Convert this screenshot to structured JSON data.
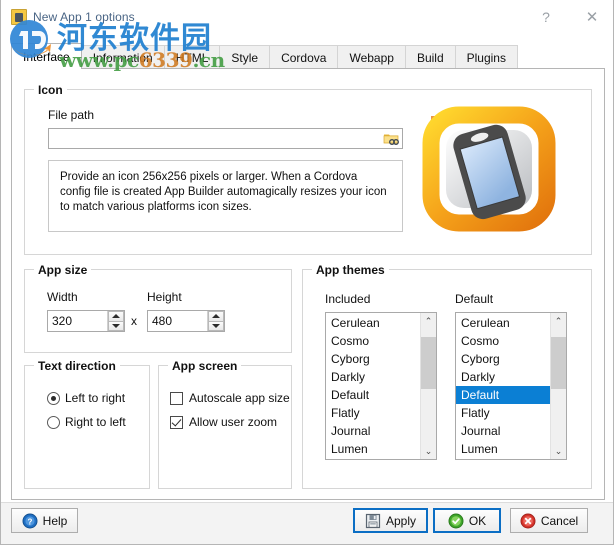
{
  "window": {
    "title": "New App 1 options",
    "icon": "app-window-icon",
    "help_button": "?",
    "close_button": "✕"
  },
  "tabs": [
    {
      "label": "Interface",
      "active": true
    },
    {
      "label": "Information",
      "active": false
    },
    {
      "label": "HTML",
      "active": false
    },
    {
      "label": "Style",
      "active": false
    },
    {
      "label": "Cordova",
      "active": false
    },
    {
      "label": "Webapp",
      "active": false
    },
    {
      "label": "Build",
      "active": false
    },
    {
      "label": "Plugins",
      "active": false
    }
  ],
  "icon_group": {
    "legend": "Icon",
    "file_path_label": "File path",
    "file_path_value": "",
    "file_path_placeholder": "",
    "browse_icon": "folder-search-icon",
    "description": "Provide an icon 256x256 pixels or larger. When a Cordova config file is created App Builder automagically resizes your icon to match various platforms icon sizes.",
    "preview_icon": "app-builder-phone-icon"
  },
  "app_size": {
    "legend": "App size",
    "width_label": "Width",
    "width_value": "320",
    "separator": "x",
    "height_label": "Height",
    "height_value": "480"
  },
  "text_direction": {
    "legend": "Text direction",
    "options": [
      {
        "label": "Left to right",
        "checked": true
      },
      {
        "label": "Right to left",
        "checked": false
      }
    ]
  },
  "app_screen": {
    "legend": "App screen",
    "options": [
      {
        "label": "Autoscale app size",
        "checked": false
      },
      {
        "label": "Allow user zoom",
        "checked": true
      }
    ]
  },
  "app_themes": {
    "legend": "App themes",
    "included_label": "Included",
    "default_label": "Default",
    "included_items": [
      "Cerulean",
      "Cosmo",
      "Cyborg",
      "Darkly",
      "Default",
      "Flatly",
      "Journal",
      "Lumen"
    ],
    "included_selected": null,
    "default_items": [
      "Cerulean",
      "Cosmo",
      "Cyborg",
      "Darkly",
      "Default",
      "Flatly",
      "Journal",
      "Lumen"
    ],
    "default_selected": "Default",
    "scroll_up_glyph": "⌃",
    "scroll_down_glyph": "⌄"
  },
  "footer": {
    "help_label": "Help",
    "apply_label": "Apply",
    "ok_label": "OK",
    "cancel_label": "Cancel"
  },
  "watermark": {
    "site_name": "河东软件园",
    "url_prefix": "www.pc",
    "url_digits": "6339",
    "url_suffix": ".cn"
  },
  "colors": {
    "selection_blue": "#0b7fd4",
    "default_button_border": "#0b6ec4",
    "title_text": "#4a6585",
    "watermark_blue": "#1f7fd0",
    "watermark_green": "#3f9b3f",
    "watermark_orange": "#d07a20",
    "icon_orange": "#f0a020",
    "icon_yellow": "#fcd116"
  }
}
